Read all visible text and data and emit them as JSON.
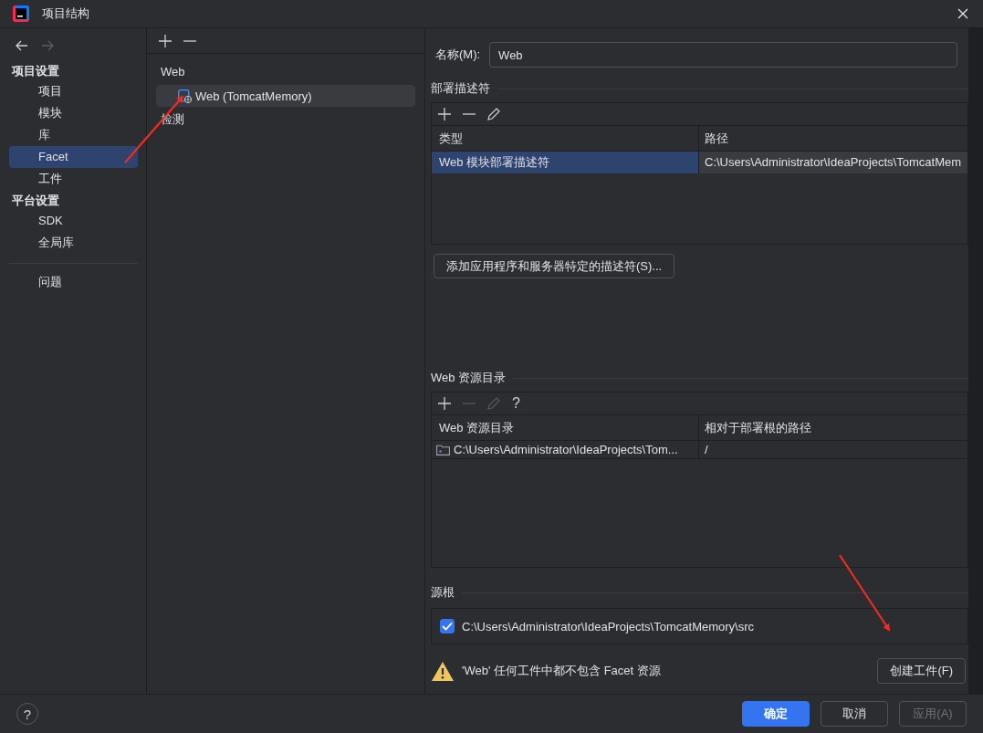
{
  "window": {
    "title": "项目结构"
  },
  "sidebar": {
    "sections": [
      {
        "heading": "项目设置",
        "items": [
          {
            "label": "项目",
            "selected": false
          },
          {
            "label": "模块",
            "selected": false
          },
          {
            "label": "库",
            "selected": false
          },
          {
            "label": "Facet",
            "selected": true
          },
          {
            "label": "工件",
            "selected": false
          }
        ]
      },
      {
        "heading": "平台设置",
        "items": [
          {
            "label": "SDK",
            "selected": false
          },
          {
            "label": "全局库",
            "selected": false
          }
        ]
      }
    ],
    "extra_items": [
      {
        "label": "问题",
        "selected": false
      }
    ]
  },
  "facet_tree": [
    {
      "label": "Web",
      "children": [
        {
          "label": "Web (TomcatMemory)",
          "selected": true
        }
      ]
    },
    {
      "label": "检测"
    }
  ],
  "name_field": {
    "label": "名称(M):",
    "value": "Web"
  },
  "deployment_descriptors": {
    "title": "部署描述符",
    "toolbar": [
      {
        "kind": "add",
        "disabled": false
      },
      {
        "kind": "remove",
        "disabled": false
      },
      {
        "kind": "edit",
        "disabled": false
      }
    ],
    "columns": [
      "类型",
      "路径"
    ],
    "rows": [
      {
        "cells": [
          "Web 模块部署描述符",
          "C:\\Users\\Administrator\\IdeaProjects\\TomcatMem"
        ],
        "selected": true
      }
    ],
    "add_button": "添加应用程序和服务器特定的描述符(S)..."
  },
  "web_resources": {
    "title": "Web 资源目录",
    "toolbar": [
      {
        "kind": "add",
        "disabled": false
      },
      {
        "kind": "remove",
        "disabled": true
      },
      {
        "kind": "edit",
        "disabled": true
      }
    ],
    "help": "?",
    "columns": [
      "Web 资源目录",
      "相对于部署根的路径"
    ],
    "rows": [
      {
        "cells": [
          "C:\\Users\\Administrator\\IdeaProjects\\Tom...",
          "/"
        ],
        "selected": false
      }
    ]
  },
  "source_roots": {
    "title": "源根",
    "items": [
      {
        "path": "C:\\Users\\Administrator\\IdeaProjects\\TomcatMemory\\src",
        "checked": true
      }
    ]
  },
  "warning": {
    "text": "'Web' 任何工件中都不包含 Facet 资源",
    "button": "创建工件(F)"
  },
  "footer": {
    "help": "?",
    "buttons": [
      {
        "label": "确定",
        "kind": "primary",
        "disabled": false
      },
      {
        "label": "取消",
        "kind": "default",
        "disabled": false
      },
      {
        "label": "应用(A)",
        "kind": "default",
        "disabled": true
      }
    ]
  }
}
